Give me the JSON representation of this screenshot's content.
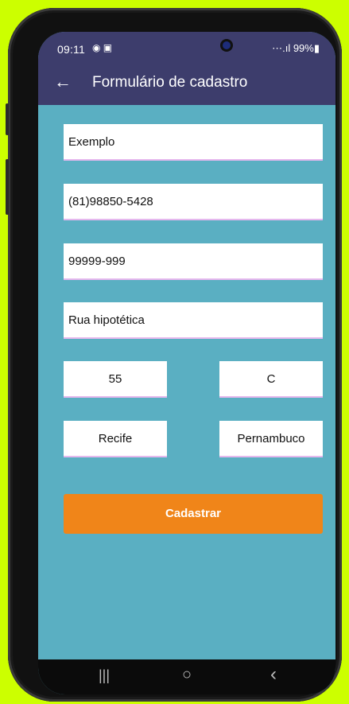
{
  "status": {
    "time": "09:11",
    "left_icons": "◉ ▣",
    "right": "⋯.ıl 99%▮"
  },
  "appbar": {
    "back_icon": "←",
    "title": "Formulário de cadastro"
  },
  "form": {
    "name": "Exemplo",
    "phone": "(81)98850-5428",
    "cep": "99999-999",
    "street": "Rua hipotética",
    "number": "55",
    "complement": "C",
    "city": "Recife",
    "state": "Pernambuco",
    "submit_label": "Cadastrar"
  },
  "nav": {
    "recents": "|||",
    "home": "○",
    "back": "‹"
  }
}
